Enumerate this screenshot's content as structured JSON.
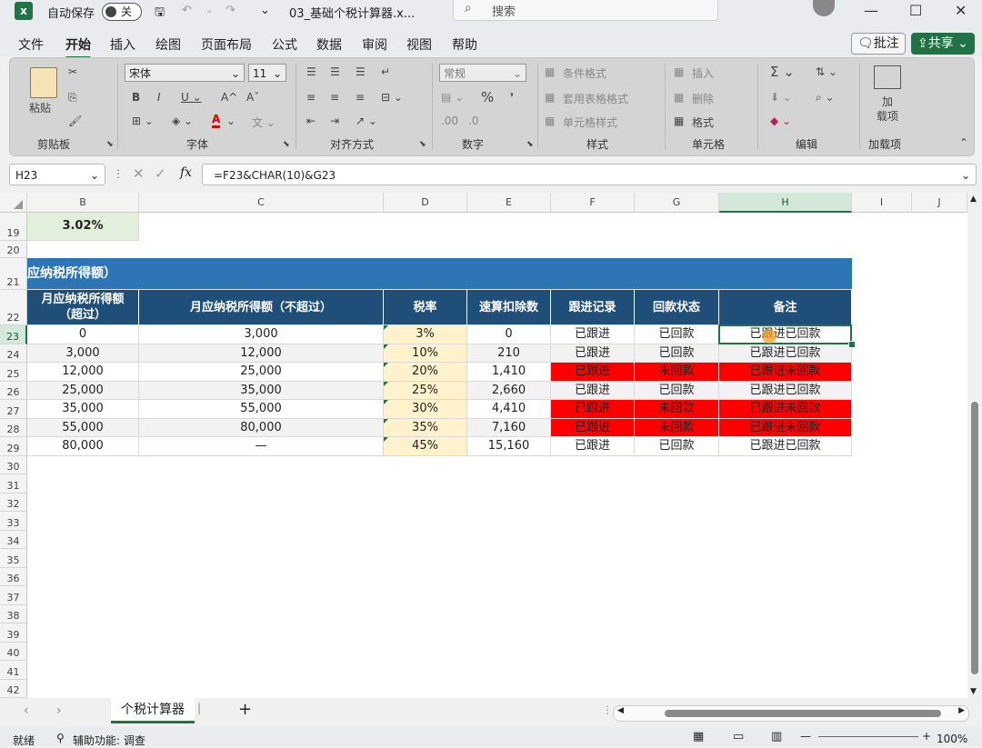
{
  "title_bar": {
    "autosave_label": "自动保存",
    "autosave_state": "关",
    "filename": "03_基础个税计算器.x...",
    "search_placeholder": "搜索"
  },
  "menu": {
    "items": [
      "文件",
      "开始",
      "插入",
      "绘图",
      "页面布局",
      "公式",
      "数据",
      "审阅",
      "视图",
      "帮助"
    ],
    "active": "开始",
    "comment_button": "批注",
    "share_button": "共享"
  },
  "ribbon": {
    "clipboard": {
      "paste": "粘贴",
      "label": "剪贴板"
    },
    "font": {
      "font_name": "宋体",
      "font_size": "11",
      "label": "字体"
    },
    "alignment": {
      "label": "对齐方式"
    },
    "number": {
      "format": "常规",
      "label": "数字"
    },
    "styles": {
      "conditional": "条件格式",
      "table": "套用表格格式",
      "cell_styles": "单元格样式",
      "label": "样式"
    },
    "cells": {
      "insert": "插入",
      "delete": "删除",
      "format": "格式",
      "label": "单元格"
    },
    "editing": {
      "label": "编辑"
    },
    "addins": {
      "button": "加\n载项",
      "label": "加载项"
    }
  },
  "formula_bar": {
    "name_box": "H23",
    "formula": "=F23&CHAR(10)&G23"
  },
  "columns": [
    "B",
    "C",
    "D",
    "E",
    "F",
    "G",
    "H",
    "I",
    "J"
  ],
  "rows": [
    "19",
    "20",
    "21",
    "22",
    "23",
    "24",
    "25",
    "26",
    "27",
    "28",
    "29",
    "30",
    "31",
    "32",
    "33",
    "34",
    "35",
    "36",
    "37",
    "38",
    "39",
    "40",
    "41",
    "42"
  ],
  "sheet": {
    "b19": "3.02%",
    "banner": "应纳税所得额）",
    "headers": [
      "月应纳税所得额（超过）",
      "月应纳税所得额（不超过）",
      "税率",
      "速算扣除数",
      "跟进记录",
      "回款状态",
      "备注"
    ],
    "table": [
      {
        "over": "0",
        "not_over": "3,000",
        "rate": "3%",
        "deduction": "0",
        "follow": "已跟进",
        "pay": "已回款",
        "note": "已跟进已回款",
        "red": false
      },
      {
        "over": "3,000",
        "not_over": "12,000",
        "rate": "10%",
        "deduction": "210",
        "follow": "已跟进",
        "pay": "已回款",
        "note": "已跟进已回款",
        "red": false
      },
      {
        "over": "12,000",
        "not_over": "25,000",
        "rate": "20%",
        "deduction": "1,410",
        "follow": "已跟进",
        "pay": "未回款",
        "note": "已跟进未回款",
        "red": true
      },
      {
        "over": "25,000",
        "not_over": "35,000",
        "rate": "25%",
        "deduction": "2,660",
        "follow": "已跟进",
        "pay": "已回款",
        "note": "已跟进已回款",
        "red": false
      },
      {
        "over": "35,000",
        "not_over": "55,000",
        "rate": "30%",
        "deduction": "4,410",
        "follow": "已跟进",
        "pay": "未回款",
        "note": "已跟进未回款",
        "red": true
      },
      {
        "over": "55,000",
        "not_over": "80,000",
        "rate": "35%",
        "deduction": "7,160",
        "follow": "已跟进",
        "pay": "未回款",
        "note": "已跟进未回款",
        "red": true
      },
      {
        "over": "80,000",
        "not_over": "—",
        "rate": "45%",
        "deduction": "15,160",
        "follow": "已跟进",
        "pay": "已回款",
        "note": "已跟进已回款",
        "red": false
      }
    ]
  },
  "tabs": {
    "active": "个税计算器",
    "add": "+"
  },
  "status": {
    "ready": "就绪",
    "accessibility": "辅助功能: 调查",
    "zoom": "100%"
  },
  "colors": {
    "excel_green": "#217346",
    "header_navy": "#1f4e79",
    "banner_blue": "#2e75b6",
    "alert_red": "#ff0000",
    "rate_yellow": "#fff2cc"
  }
}
